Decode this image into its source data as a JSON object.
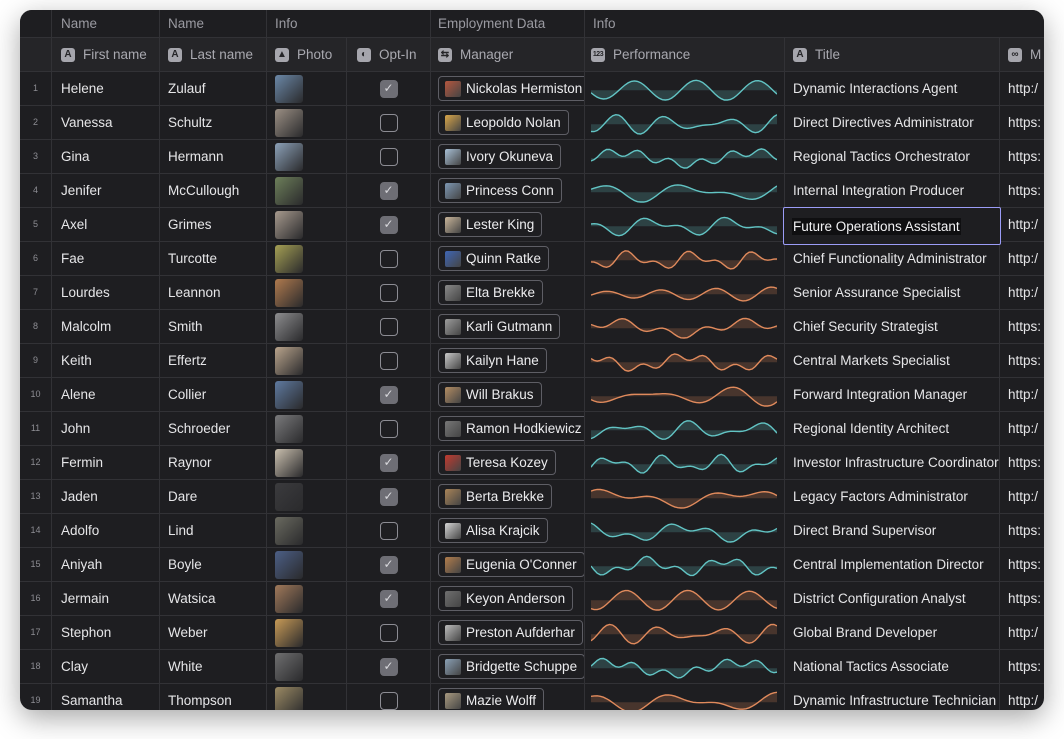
{
  "groups": [
    {
      "label": ""
    },
    {
      "label": "Name"
    },
    {
      "label": "Name"
    },
    {
      "label": "Info"
    },
    {
      "label": "Employment Data"
    },
    {
      "label": "Info"
    }
  ],
  "columns": [
    {
      "label": "First name",
      "icon": "text-column-icon",
      "glyph": "A"
    },
    {
      "label": "Last name",
      "icon": "text-column-icon",
      "glyph": "A"
    },
    {
      "label": "Photo",
      "icon": "image-column-icon",
      "glyph": "▲"
    },
    {
      "label": "Opt-In",
      "icon": "toggle-column-icon",
      "glyph": "◐"
    },
    {
      "label": "Manager",
      "icon": "user-column-icon",
      "glyph": "⇆"
    },
    {
      "label": "Performance",
      "icon": "number-column-icon",
      "glyph": "123"
    },
    {
      "label": "Title",
      "icon": "text-column-icon",
      "glyph": "A"
    },
    {
      "label": "M",
      "icon": "link-column-icon",
      "glyph": "∞"
    }
  ],
  "selected_row": 5,
  "rows": [
    {
      "index": "1",
      "first": "Helene",
      "last": "Zulauf",
      "opt": true,
      "manager": "Nickolas Hermiston",
      "perf": "teal",
      "title": "Dynamic Interactions Agent",
      "url": "http:/",
      "photo": "#6b88a8",
      "avatar": "#b5573f"
    },
    {
      "index": "2",
      "first": "Vanessa",
      "last": "Schultz",
      "opt": false,
      "manager": "Leopoldo Nolan",
      "perf": "teal",
      "title": "Direct Directives Administrator",
      "url": "https:",
      "photo": "#9b8f84",
      "avatar": "#d9a64a"
    },
    {
      "index": "3",
      "first": "Gina",
      "last": "Hermann",
      "opt": false,
      "manager": "Ivory Okuneva",
      "perf": "teal",
      "title": "Regional Tactics Orchestrator",
      "url": "https:",
      "photo": "#8ca1b8",
      "avatar": "#a8c0d6"
    },
    {
      "index": "4",
      "first": "Jenifer",
      "last": "McCullough",
      "opt": true,
      "manager": "Princess Conn",
      "perf": "teal",
      "title": "Internal Integration Producer",
      "url": "https:",
      "photo": "#6d7f5a",
      "avatar": "#7e98b3"
    },
    {
      "index": "5",
      "first": "Axel",
      "last": "Grimes",
      "opt": true,
      "manager": "Lester King",
      "perf": "teal",
      "title": "Future Operations Assistant",
      "url": "http:/",
      "photo": "#a79a8e",
      "avatar": "#c9b59a"
    },
    {
      "index": "6",
      "first": "Fae",
      "last": "Turcotte",
      "opt": false,
      "manager": "Quinn Ratke",
      "perf": "orange",
      "title": "Chief Functionality Administrator",
      "url": "http:/",
      "photo": "#a5a054",
      "avatar": "#3f66b5"
    },
    {
      "index": "7",
      "first": "Lourdes",
      "last": "Leannon",
      "opt": false,
      "manager": "Elta Brekke",
      "perf": "orange",
      "title": "Senior Assurance Specialist",
      "url": "http:/",
      "photo": "#b07a4e",
      "avatar": "#8a8a8a"
    },
    {
      "index": "8",
      "first": "Malcolm",
      "last": "Smith",
      "opt": false,
      "manager": "Karli Gutmann",
      "perf": "orange",
      "title": "Chief Security Strategist",
      "url": "https:",
      "photo": "#8d8d8f",
      "avatar": "#9c9c9c"
    },
    {
      "index": "9",
      "first": "Keith",
      "last": "Effertz",
      "opt": false,
      "manager": "Kailyn Hane",
      "perf": "orange",
      "title": "Central Markets Specialist",
      "url": "https:",
      "photo": "#b9a48c",
      "avatar": "#c8c8c8"
    },
    {
      "index": "10",
      "first": "Alene",
      "last": "Collier",
      "opt": true,
      "manager": "Will Brakus",
      "perf": "orange",
      "title": "Forward Integration Manager",
      "url": "http:/",
      "photo": "#5f7aa0",
      "avatar": "#b38d63"
    },
    {
      "index": "11",
      "first": "John",
      "last": "Schroeder",
      "opt": false,
      "manager": "Ramon Hodkiewicz",
      "perf": "teal",
      "title": "Regional Identity Architect",
      "url": "http:/",
      "photo": "#7a7a7c",
      "avatar": "#777777"
    },
    {
      "index": "12",
      "first": "Fermin",
      "last": "Raynor",
      "opt": true,
      "manager": "Teresa Kozey",
      "perf": "teal",
      "title": "Investor Infrastructure Coordinator",
      "url": "https:",
      "photo": "#c9bfae",
      "avatar": "#c23a2f"
    },
    {
      "index": "13",
      "first": "Jaden",
      "last": "Dare",
      "opt": true,
      "manager": "Berta Brekke",
      "perf": "orange",
      "title": "Legacy Factors Administrator",
      "url": "http:/",
      "photo": "#3b3b3e",
      "avatar": "#a98458"
    },
    {
      "index": "14",
      "first": "Adolfo",
      "last": "Lind",
      "opt": false,
      "manager": "Alisa Krajcik",
      "perf": "teal",
      "title": "Direct Brand Supervisor",
      "url": "https:",
      "photo": "#6a6a60",
      "avatar": "#d5d5d5"
    },
    {
      "index": "15",
      "first": "Aniyah",
      "last": "Boyle",
      "opt": true,
      "manager": "Eugenia O'Conner",
      "perf": "teal",
      "title": "Central Implementation Director",
      "url": "https:",
      "photo": "#4c5f86",
      "avatar": "#b27d4c"
    },
    {
      "index": "16",
      "first": "Jermain",
      "last": "Watsica",
      "opt": true,
      "manager": "Keyon Anderson",
      "perf": "orange",
      "title": "District Configuration Analyst",
      "url": "https:",
      "photo": "#a1795a",
      "avatar": "#6f6f6f"
    },
    {
      "index": "17",
      "first": "Stephon",
      "last": "Weber",
      "opt": false,
      "manager": "Preston Aufderhar",
      "perf": "orange",
      "title": "Global Brand Developer",
      "url": "http:/",
      "photo": "#c79a56",
      "avatar": "#bcbcbc"
    },
    {
      "index": "18",
      "first": "Clay",
      "last": "White",
      "opt": true,
      "manager": "Bridgette Schuppe",
      "perf": "teal",
      "title": "National Tactics Associate",
      "url": "https:",
      "photo": "#6f6f70",
      "avatar": "#8aa0b5"
    },
    {
      "index": "19",
      "first": "Samantha",
      "last": "Thompson",
      "opt": false,
      "manager": "Mazie Wolff",
      "perf": "orange",
      "title": "Dynamic Infrastructure Technician",
      "url": "http:/",
      "photo": "#9b8a64",
      "avatar": "#a89a80"
    }
  ],
  "colors": {
    "background": "#1e1e21",
    "header": "#252528",
    "teal": "#62c4c4",
    "orange": "#e08a5c",
    "selection": "#9b9cf7"
  }
}
